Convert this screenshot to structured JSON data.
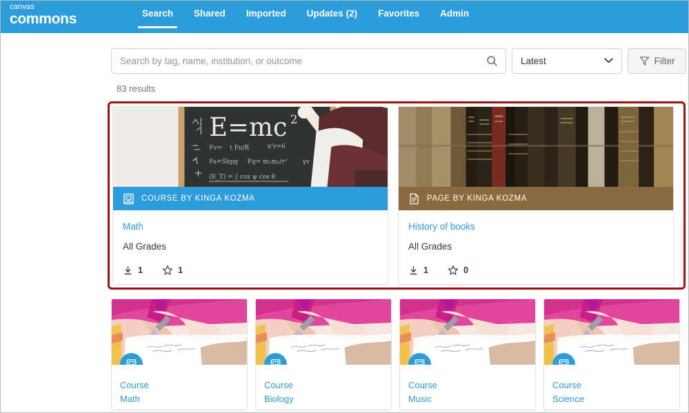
{
  "header": {
    "logo_top": "canvas",
    "logo_bottom": "commons",
    "nav": [
      {
        "label": "Search",
        "active": true
      },
      {
        "label": "Shared",
        "active": false
      },
      {
        "label": "Imported",
        "active": false
      },
      {
        "label": "Updates (2)",
        "active": false
      },
      {
        "label": "Favorites",
        "active": false
      },
      {
        "label": "Admin",
        "active": false
      }
    ]
  },
  "toolbar": {
    "search_placeholder": "Search by tag, name, institution, or outcome",
    "search_value": "",
    "search_icon": "search-icon",
    "sort_value": "Latest",
    "sort_icon": "chevron-down-icon",
    "filter_label": "Filter",
    "filter_icon": "funnel-icon"
  },
  "results": {
    "count_label": "83 results"
  },
  "featured": {
    "cards": [
      {
        "banner_text": "COURSE BY KINGA KOZMA",
        "banner_color": "#2d9cdb",
        "banner_icon": "book-icon",
        "title": "Math",
        "grades": "All Grades",
        "downloads": "1",
        "favorites": "1",
        "download_icon": "download-icon",
        "star_icon": "star-icon",
        "image": "chalkboard"
      },
      {
        "banner_text": "PAGE BY KINGA KOZMA",
        "banner_color": "#8a6a3f",
        "banner_icon": "page-icon",
        "title": "History of books",
        "grades": "All Grades",
        "downloads": "1",
        "favorites": "0",
        "download_icon": "download-icon",
        "star_icon": "star-icon",
        "image": "books"
      }
    ]
  },
  "more_results": {
    "cards": [
      {
        "type": "Course",
        "title": "Math",
        "badge_icon": "book-icon",
        "image": "writing"
      },
      {
        "type": "Course",
        "title": "Biology",
        "badge_icon": "book-icon",
        "image": "writing"
      },
      {
        "type": "Course",
        "title": "Music",
        "badge_icon": "book-icon",
        "image": "writing"
      },
      {
        "type": "Course",
        "title": "Science",
        "badge_icon": "book-icon",
        "image": "writing"
      }
    ]
  },
  "colors": {
    "brand_blue": "#2d9cdb",
    "page_brown": "#8a6a3f",
    "highlight_red": "#9d1212",
    "link_blue": "#2d9cdb"
  }
}
